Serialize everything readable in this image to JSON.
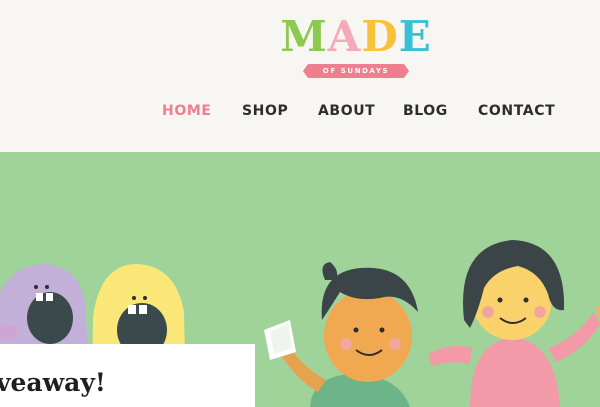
{
  "logo": {
    "letters": [
      {
        "char": "M",
        "color": "#8dc94f"
      },
      {
        "char": "A",
        "color": "#f3a9b7"
      },
      {
        "char": "D",
        "color": "#f7c23a"
      },
      {
        "char": "E",
        "color": "#36c1d5"
      }
    ],
    "tagline": "OF SUNDAYS"
  },
  "nav": {
    "items": [
      {
        "label": "HOME",
        "active": true
      },
      {
        "label": "SHOP",
        "active": false
      },
      {
        "label": "ABOUT",
        "active": false
      },
      {
        "label": "BLOG",
        "active": false
      },
      {
        "label": "CONTACT",
        "active": false
      }
    ]
  },
  "post": {
    "title": "veaway!"
  },
  "colors": {
    "accent": "#ef7f8e",
    "nav_text": "#2d2d2d",
    "header_bg": "#f8f6f2",
    "hero_bg": "#9fd39a"
  }
}
